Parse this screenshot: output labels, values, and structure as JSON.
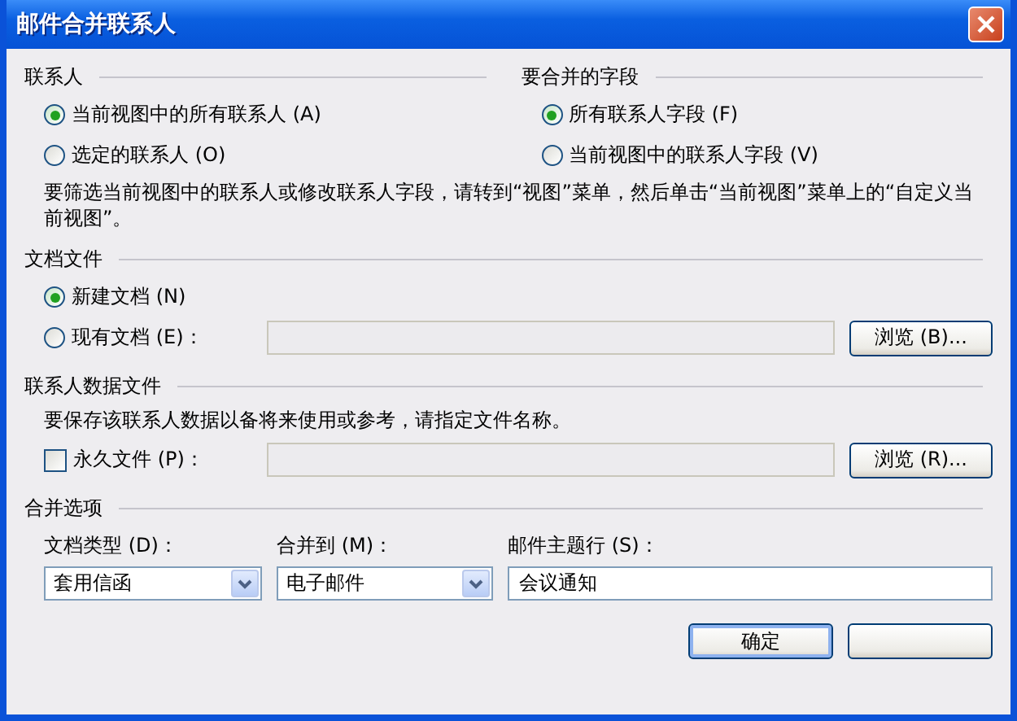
{
  "window": {
    "title": "邮件合并联系人"
  },
  "contacts": {
    "heading": "联系人",
    "options": [
      {
        "label": "当前视图中的所有联系人 (A)",
        "selected": true
      },
      {
        "label": "选定的联系人 (O)",
        "selected": false
      }
    ]
  },
  "fields": {
    "heading": "要合并的字段",
    "options": [
      {
        "label": "所有联系人字段 (F)",
        "selected": true
      },
      {
        "label": "当前视图中的联系人字段 (V)",
        "selected": false
      }
    ]
  },
  "filter_hint": "要筛选当前视图中的联系人或修改联系人字段，请转到“视图”菜单，然后单击“当前视图”菜单上的“自定义当前视图”。",
  "document_file": {
    "heading": "文档文件",
    "options": [
      {
        "label": "新建文档 (N)",
        "selected": true
      },
      {
        "label": "现有文档 (E)：",
        "selected": false
      }
    ],
    "path": {
      "disabled": true
    },
    "browse_button": "浏览 (B)..."
  },
  "data_file": {
    "heading": "联系人数据文件",
    "hint": "要保存该联系人数据以备将来使用或参考，请指定文件名称。",
    "permanent": {
      "label": "永久文件 (P)：",
      "checked": false
    },
    "path": {
      "disabled": true
    },
    "browse_button": "浏览 (R)..."
  },
  "merge_options": {
    "heading": "合并选项",
    "document_type": {
      "label": "文档类型 (D)：",
      "value": "套用信函"
    },
    "merge_to": {
      "label": "合并到 (M)：",
      "value": "电子邮件"
    },
    "subject_line": {
      "label": "邮件主题行 (S)：",
      "value": "会议通知"
    }
  },
  "buttons": [
    {
      "label": "确定",
      "default": true
    },
    {
      "default": false
    }
  ]
}
